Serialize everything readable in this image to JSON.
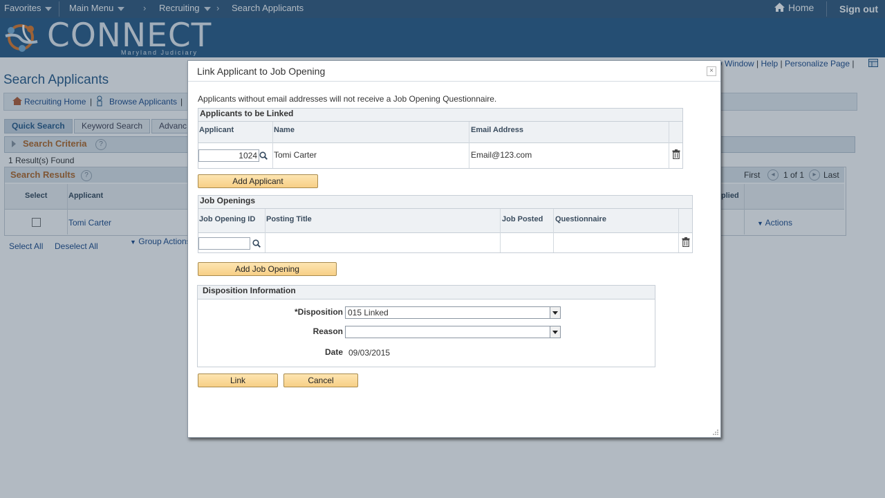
{
  "topbar": {
    "favorites": "Favorites",
    "main_menu": "Main Menu",
    "recruiting": "Recruiting",
    "search_applicants": "Search Applicants",
    "home": "Home",
    "sign_out": "Sign out"
  },
  "banner": {
    "logo_text": "CONNECT",
    "logo_sub": "Maryland Judiciary"
  },
  "page": {
    "title": "Search Applicants",
    "header_links": {
      "new_window": "w Window",
      "help": "Help",
      "personalize": "Personalize Page"
    },
    "nav_links": [
      "Recruiting Home",
      "Browse Applicants"
    ],
    "tabs": [
      "Quick Search",
      "Keyword Search",
      "Advanc"
    ],
    "search_criteria": "Search Criteria",
    "results_found": "1 Result(s) Found",
    "search_results": "Search Results",
    "pager": {
      "first": "First",
      "count": "1 of 1",
      "last": "Last"
    },
    "columns": {
      "select": "Select",
      "applicant": "Applicant",
      "applied": "plied"
    },
    "row": {
      "applicant": "Tomi Carter",
      "actions": "Actions"
    },
    "select_all": "Select All",
    "deselect_all": "Deselect All",
    "group_actions": "Group Actions"
  },
  "modal": {
    "title": "Link Applicant to Job Opening",
    "close": "×",
    "notice": "Applicants without email addresses will not receive a Job Opening Questionnaire.",
    "applicants": {
      "section_title": "Applicants to be Linked",
      "columns": [
        "Applicant",
        "Name",
        "Email Address"
      ],
      "rows": [
        {
          "applicant": "1024",
          "name": "Tomi Carter",
          "email": "Email@123.com"
        }
      ],
      "add_button": "Add Applicant"
    },
    "job_openings": {
      "section_title": "Job Openings",
      "columns": [
        "Job Opening ID",
        "Posting Title",
        "Job Posted",
        "Questionnaire"
      ],
      "job_opening_id": "",
      "add_button": "Add Job Opening"
    },
    "disposition": {
      "section_title": "Disposition Information",
      "disposition_label": "*Disposition",
      "disposition_value": "015 Linked",
      "reason_label": "Reason",
      "reason_value": "",
      "date_label": "Date",
      "date_value": "09/03/2015"
    },
    "link_button": "Link",
    "cancel_button": "Cancel"
  },
  "colors": {
    "topbar": "#365d80",
    "banner": "#2d5e8a",
    "section_title": "#b36a2c",
    "button": "#f7cf86"
  },
  "icons": [
    "home-icon",
    "lookup-icon",
    "trash-icon",
    "close-icon",
    "help-icon",
    "dropdown-arrow-icon"
  ]
}
